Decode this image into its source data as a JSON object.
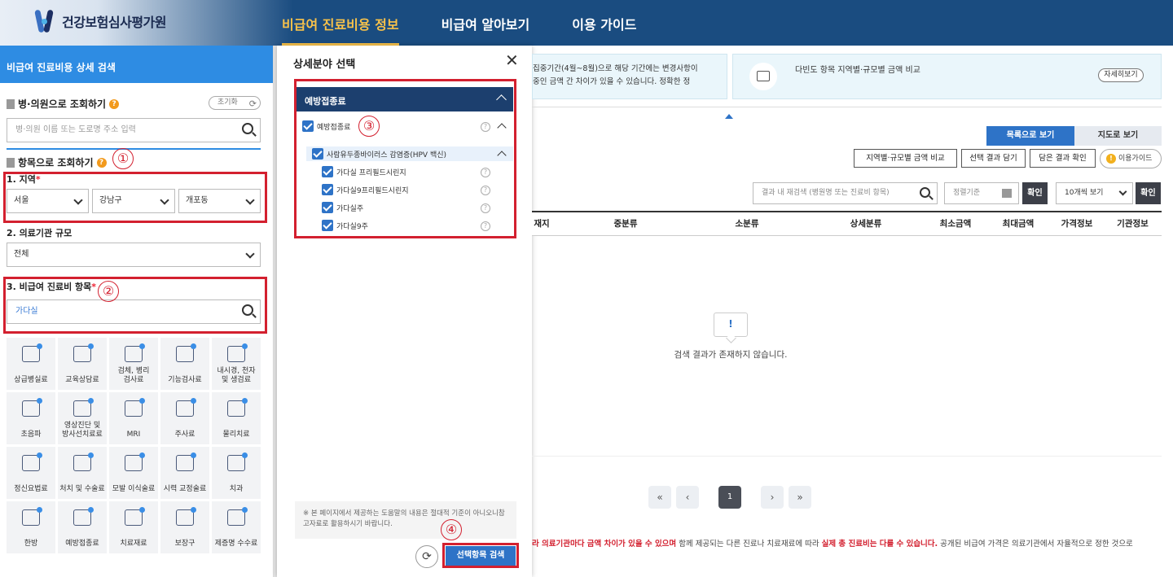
{
  "header": {
    "logo_text": "건강보험심사평가원",
    "nav": [
      {
        "label": "비급여 진료비용 정보",
        "active": true
      },
      {
        "label": "비급여 알아보기",
        "active": false
      },
      {
        "label": "이용 가이드",
        "active": false
      }
    ]
  },
  "colors": {
    "primary": "#2e73c7",
    "header_bg": "#1a4c80",
    "accent_red": "#d3202f",
    "nav_active": "#f8c24a"
  },
  "left": {
    "title": "비급여 진료비용 상세 검색",
    "by_hospital": {
      "title": "병·의원으로 조회하기",
      "reset": "초기화",
      "placeholder": "병·의원 이름 또는 도로명 주소 입력"
    },
    "by_item": {
      "title": "항목으로 조회하기"
    },
    "region": {
      "label": "1. 지역",
      "star": "*",
      "values": [
        "서울",
        "강남구",
        "개포동"
      ]
    },
    "scale": {
      "label": "2. 의료기관 규모",
      "value": "전체"
    },
    "item": {
      "label": "3. 비급여 진료비 항목",
      "star": "*",
      "value": "가다실"
    },
    "categories": [
      [
        "상급병실료"
      ],
      [
        "교육상담료"
      ],
      [
        "검체, 병리",
        "검사료"
      ],
      [
        "기능검사료"
      ],
      [
        "내시경, 천자",
        "및 생검료"
      ],
      [
        "초음파"
      ],
      [
        "영상진단 및",
        "방사선치료료"
      ],
      [
        "MRI"
      ],
      [
        "주사료"
      ],
      [
        "물리치료"
      ],
      [
        "정신요법료"
      ],
      [
        "처치 및 수술료"
      ],
      [
        "모발 이식술료"
      ],
      [
        "시력 교정술료"
      ],
      [
        "치과"
      ],
      [
        "한방"
      ],
      [
        "예방접종료"
      ],
      [
        "치료재료"
      ],
      [
        "보장구"
      ],
      [
        "제증명 수수료"
      ]
    ]
  },
  "modal": {
    "title": "상세분야 선택",
    "close": "✕",
    "group": "예방접종료",
    "parent": "예방접종료",
    "sub_group": "사람유두종바이러스 감염증(HPV 백신)",
    "items": [
      "가다실 프리필드시린지",
      "가다실9프리필드시린지",
      "가다실주",
      "가다실9주"
    ],
    "note": "※ 본 페이지에서 제공하는 도움말의 내용은 절대적 기준이 아니오니참고자료로 활용하시기 바랍니다.",
    "apply": "선택항목 검색",
    "refresh": "⟳"
  },
  "annotations": [
    "①",
    "②",
    "③",
    "④"
  ],
  "right": {
    "notice1_lines": [
      "집중기간(4월~8월)으로 해당 기간에는 변경사항이",
      "중인 금액 간 차이가 있을 수 있습니다. 정확한 정"
    ],
    "notice2": {
      "title": "다빈도 항목 지역별·규모별 금액 비교",
      "button": "자세히보기"
    },
    "view_list": "목록으로 보기",
    "view_map": "지도로 보기",
    "tools": [
      "지역별·규모별 금액 비교",
      "선택 결과 담기",
      "담은 결과 확인"
    ],
    "guide": "이용가이드",
    "guide_icon": "!",
    "research_placeholder": "결과 내 재검색 (병원명 또는 진료비 항목)",
    "sort_placeholder": "정렬기준",
    "ok": "확인",
    "per_page": "10개씩 보기",
    "columns": [
      "재지",
      "중분류",
      "소분류",
      "상세분류",
      "최소금액",
      "최대금액",
      "가격정보",
      "기관정보"
    ],
    "empty_icon": "!",
    "empty": "검색 결과가 존재하지 않습니다.",
    "pager": {
      "first": "«",
      "prev": "‹",
      "current": "1",
      "next": "›",
      "last": "»"
    },
    "bottom": {
      "red1": "라 의료기관마다 금액 차이가 있을 수 있으며",
      "mid": " 함께 제공되는 다른 진료나 치료재료에 따라 ",
      "red2": "실제 총 진료비는 다를 수 있습니다.",
      "tail": " 공개된 비급여 가격은 의료기관에서 자율적으로 정한 것으로"
    }
  }
}
